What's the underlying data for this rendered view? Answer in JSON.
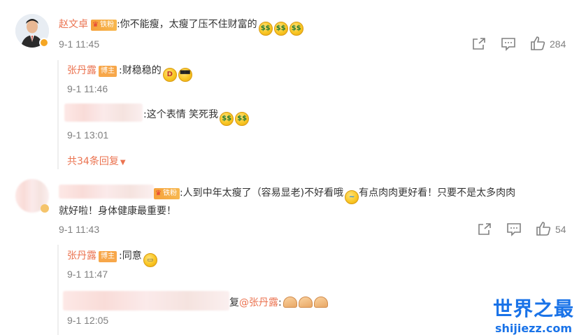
{
  "comment1": {
    "username": "赵文卓",
    "fan_badge": "铁粉",
    "text": ":你不能瘦，太瘦了压不住财富的",
    "emojis": [
      "$$",
      "$$",
      "$$"
    ],
    "time": "9-1 11:45",
    "likes": "284",
    "replies": [
      {
        "username": "张丹露",
        "role_badge": "博主",
        "text": ":财稳稳的",
        "time": "9-1 11:46"
      },
      {
        "text": ":这个表情 笑死我",
        "emojis": [
          "$$",
          "$$"
        ],
        "time": "9-1 13:01"
      }
    ],
    "more_replies": "共34条回复"
  },
  "comment2": {
    "fan_badge": "铁粉",
    "text_line1": ":人到中年太瘦了（容易显老)不好看哦",
    "text_line1b": "有点肉肉更好看！只要不是太多肉肉",
    "text_line2": "就好啦！身体健康最重要！",
    "time": "9-1 11:43",
    "likes": "54",
    "replies": [
      {
        "username": "张丹露",
        "role_badge": "博主",
        "text": ":同意",
        "time": "9-1 11:47"
      },
      {
        "text_prefix": "复",
        "mention": "@张丹露",
        "text": ":",
        "time": "9-1 12:05"
      }
    ]
  },
  "watermark": {
    "title": "世界之最",
    "domain": "shijiezz.com"
  },
  "icons": {
    "share": "share-icon",
    "comment": "comment-icon",
    "like": "thumb-up-icon",
    "dropdown": "triangle-down-icon"
  },
  "colors": {
    "username": "#eb7350",
    "muted": "#808080",
    "badge": "#f7a74a",
    "watermark": "#1a73e8"
  }
}
